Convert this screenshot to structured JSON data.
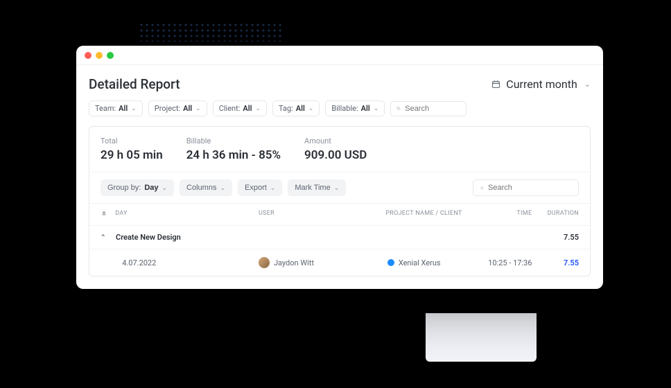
{
  "header": {
    "title": "Detailed Report",
    "date_range": "Current month"
  },
  "filters": {
    "team": {
      "label": "Team:",
      "value": "All"
    },
    "project": {
      "label": "Project:",
      "value": "All"
    },
    "client": {
      "label": "Client:",
      "value": "All"
    },
    "tag": {
      "label": "Tag:",
      "value": "All"
    },
    "billable": {
      "label": "Billable:",
      "value": "All"
    },
    "search_placeholder": "Search"
  },
  "summary": {
    "total": {
      "label": "Total",
      "value": "29 h 05 min"
    },
    "billable": {
      "label": "Billable",
      "value": "24 h 36 min - 85%"
    },
    "amount": {
      "label": "Amount",
      "value": "909.00 USD"
    }
  },
  "toolbar": {
    "group_by": {
      "label": "Group by:",
      "value": "Day"
    },
    "columns": "Columns",
    "export": "Export",
    "mark_time": "Mark Time",
    "search_placeholder": "Search"
  },
  "table": {
    "headers": {
      "day": "DAY",
      "user": "USER",
      "project": "PROJECT NAME / CLIENT",
      "time": "TIME",
      "duration": "DURATION"
    },
    "group": {
      "task": "Create New Design",
      "duration": "7.55"
    },
    "row": {
      "date": "4.07.2022",
      "user": "Jaydon Witt",
      "project": "Xenial Xerus",
      "time": "10:25 - 17:36",
      "duration": "7.55"
    }
  }
}
